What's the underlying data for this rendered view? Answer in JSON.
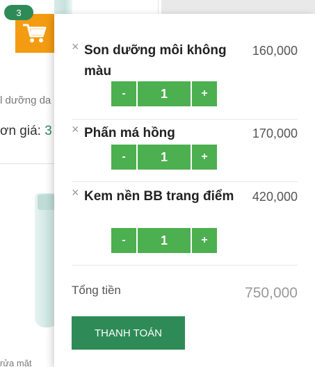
{
  "header": {
    "cart_count": "3"
  },
  "background": {
    "product_desc": "l dưỡng da",
    "price_label": "ơn giá: ",
    "price_value": "3",
    "bottom_text": "rửa mặt"
  },
  "cart": {
    "items": [
      {
        "name": "Son dưỡng môi không màu",
        "price": "160,000",
        "quantity": "1"
      },
      {
        "name": "Phấn má hồng",
        "price": "170,000",
        "quantity": "1"
      },
      {
        "name": "Kem nền BB trang điểm",
        "price": "420,000",
        "quantity": "1"
      }
    ],
    "remove_glyph": "×",
    "minus_label": "-",
    "plus_label": "+",
    "total_label": "Tổng tiền",
    "total_value": "750,000",
    "checkout_label": "THANH TOÁN"
  },
  "icons": [
    "cart-icon",
    "close-icon"
  ],
  "colors": {
    "accent": "#f39c12",
    "badge": "#2e8b57",
    "button": "#4caf50",
    "checkout": "#2e8b57"
  }
}
